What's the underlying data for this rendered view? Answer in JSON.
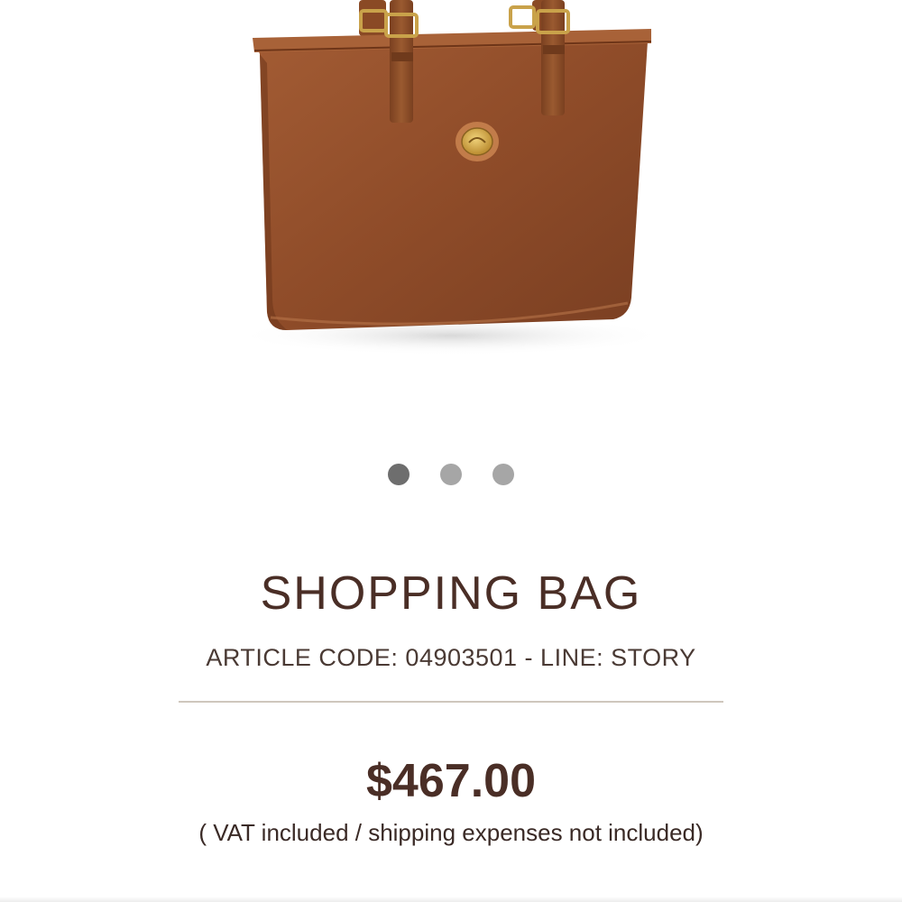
{
  "product": {
    "image": {
      "icon": "leather-tote-bag",
      "colors": {
        "leather": "#9a5530",
        "strap": "#8a4a25",
        "hardware": "#c9a24a"
      }
    },
    "carousel": {
      "total_slides": 3,
      "active_index": 0
    },
    "title": "SHOPPING BAG",
    "article_line": "ARTICLE CODE: 04903501 - LINE: STORY",
    "price": "$467.00",
    "price_note": "( VAT included / shipping expenses not included)"
  },
  "theme": {
    "brand_brown": "#4a2e26",
    "divider": "#cfc7bd",
    "dot_active": "#6e6e6e",
    "dot_inactive": "#a6a6a6"
  }
}
